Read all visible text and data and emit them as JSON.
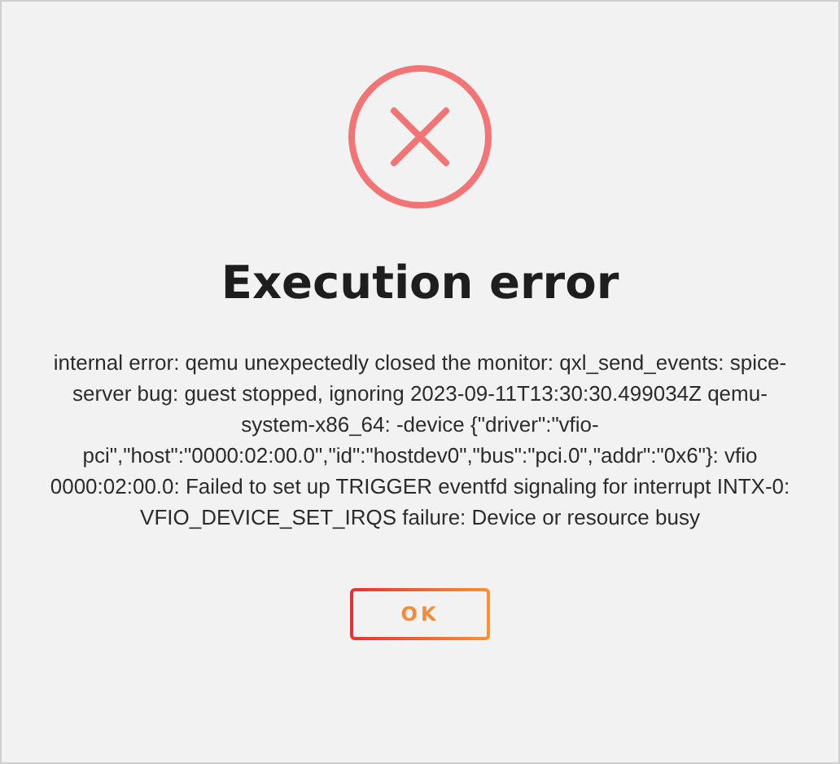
{
  "dialog": {
    "title": "Execution error",
    "message": "internal error: qemu unexpectedly closed the monitor: qxl_send_events: spice-server bug: guest stopped, ignoring 2023-09-11T13:30:30.499034Z qemu-system-x86_64: -device {\"driver\":\"vfio-pci\",\"host\":\"0000:02:00.0\",\"id\":\"hostdev0\",\"bus\":\"pci.0\",\"addr\":\"0x6\"}: vfio 0000:02:00.0: Failed to set up TRIGGER eventfd signaling for interrupt INTX-0: VFIO_DEVICE_SET_IRQS failure: Device or resource busy",
    "buttons": [
      "OK"
    ]
  }
}
